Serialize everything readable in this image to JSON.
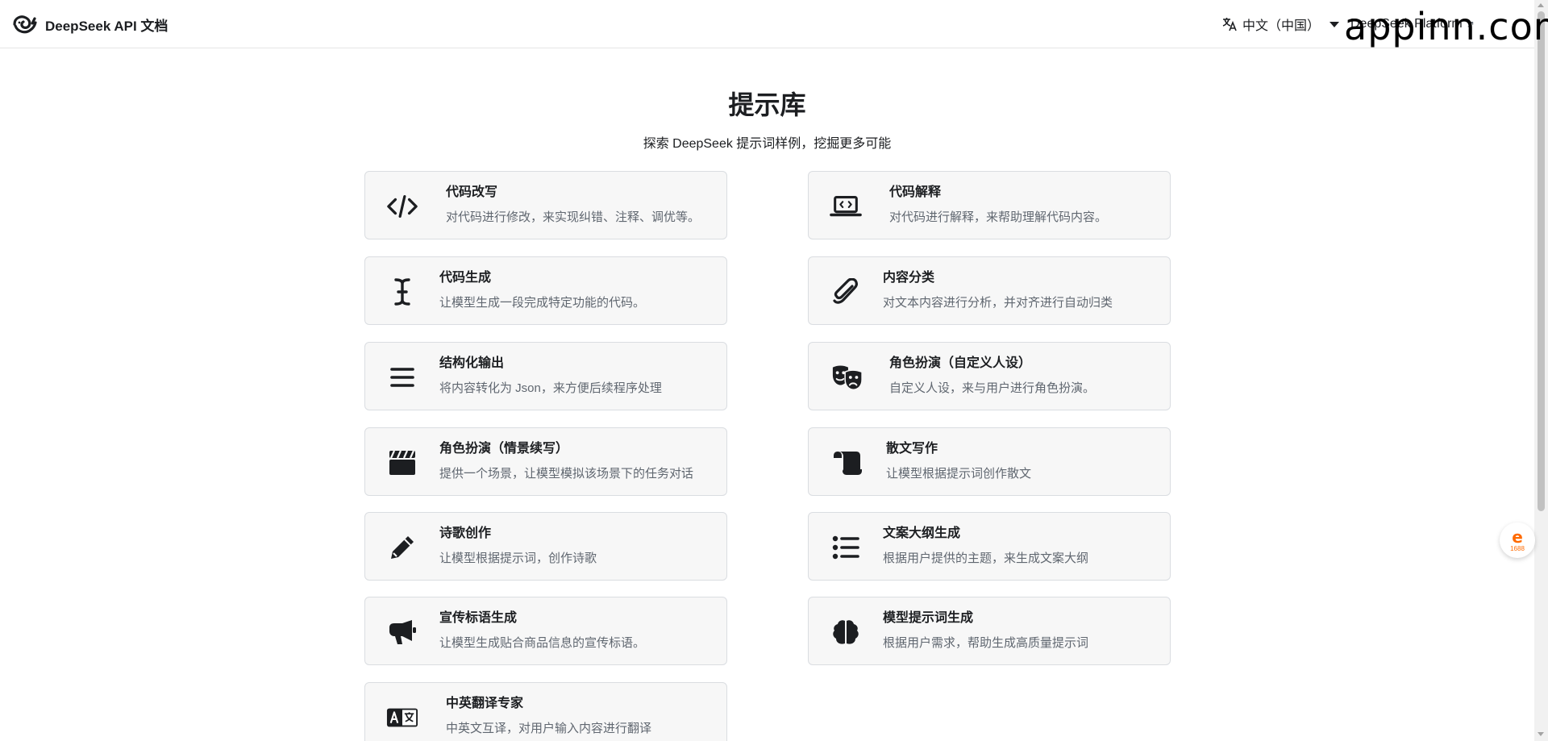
{
  "navbar": {
    "brand_title": "DeepSeek API 文档",
    "language_label": "中文（中国）",
    "platform_label": "DeepSeek Platform"
  },
  "watermark": "appinn.com",
  "side_widget": {
    "number": "1688"
  },
  "page": {
    "title": "提示库",
    "subtitle": "探索 DeepSeek 提示词样例，挖掘更多可能"
  },
  "cards": [
    {
      "title": "代码改写",
      "desc": "对代码进行修改，来实现纠错、注释、调优等。",
      "icon": "code-icon"
    },
    {
      "title": "代码解释",
      "desc": "对代码进行解释，来帮助理解代码内容。",
      "icon": "laptop-code-icon"
    },
    {
      "title": "代码生成",
      "desc": "让模型生成一段完成特定功能的代码。",
      "icon": "text-cursor-icon"
    },
    {
      "title": "内容分类",
      "desc": "对文本内容进行分析，并对齐进行自动归类",
      "icon": "paperclip-icon"
    },
    {
      "title": "结构化输出",
      "desc": "将内容转化为 Json，来方便后续程序处理",
      "icon": "bars-icon"
    },
    {
      "title": "角色扮演（自定义人设）",
      "desc": "自定义人设，来与用户进行角色扮演。",
      "icon": "theater-masks-icon"
    },
    {
      "title": "角色扮演（情景续写）",
      "desc": "提供一个场景，让模型模拟该场景下的任务对话",
      "icon": "clapperboard-icon"
    },
    {
      "title": "散文写作",
      "desc": "让模型根据提示词创作散文",
      "icon": "scroll-icon"
    },
    {
      "title": "诗歌创作",
      "desc": "让模型根据提示词，创作诗歌",
      "icon": "pencil-icon"
    },
    {
      "title": "文案大纲生成",
      "desc": "根据用户提供的主题，来生成文案大纲",
      "icon": "list-icon"
    },
    {
      "title": "宣传标语生成",
      "desc": "让模型生成贴合商品信息的宣传标语。",
      "icon": "bullhorn-icon"
    },
    {
      "title": "模型提示词生成",
      "desc": "根据用户需求，帮助生成高质量提示词",
      "icon": "brain-icon"
    },
    {
      "title": "中英翻译专家",
      "desc": "中英文互译，对用户输入内容进行翻译",
      "icon": "language-icon"
    }
  ]
}
